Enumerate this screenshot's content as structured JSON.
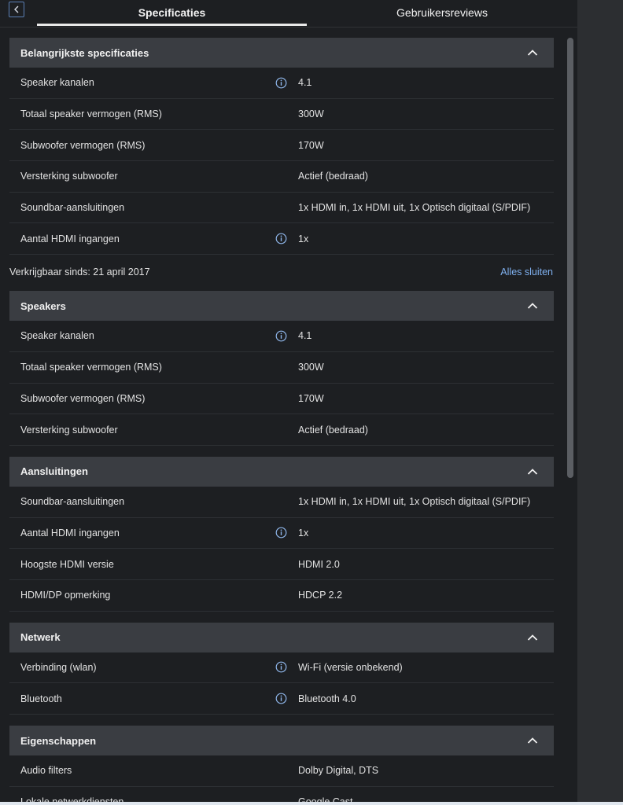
{
  "tabs": [
    {
      "label": "Specificaties",
      "active": true
    },
    {
      "label": "Gebruikersreviews",
      "active": false
    }
  ],
  "sections": [
    {
      "title": "Belangrijkste specificaties",
      "rows": [
        {
          "label": "Speaker kanalen",
          "value": "4.1",
          "info": true
        },
        {
          "label": "Totaal speaker vermogen (RMS)",
          "value": "300W",
          "info": false
        },
        {
          "label": "Subwoofer vermogen (RMS)",
          "value": "170W",
          "info": false
        },
        {
          "label": "Versterking subwoofer",
          "value": "Actief (bedraad)",
          "info": false
        },
        {
          "label": "Soundbar-aansluitingen",
          "value": "1x HDMI in, 1x HDMI uit, 1x Optisch digitaal (S/PDIF)",
          "info": false
        },
        {
          "label": "Aantal HDMI ingangen",
          "value": "1x",
          "info": true
        }
      ]
    },
    {
      "title": "Speakers",
      "rows": [
        {
          "label": "Speaker kanalen",
          "value": "4.1",
          "info": true
        },
        {
          "label": "Totaal speaker vermogen (RMS)",
          "value": "300W",
          "info": false
        },
        {
          "label": "Subwoofer vermogen (RMS)",
          "value": "170W",
          "info": false
        },
        {
          "label": "Versterking subwoofer",
          "value": "Actief (bedraad)",
          "info": false
        }
      ]
    },
    {
      "title": "Aansluitingen",
      "rows": [
        {
          "label": "Soundbar-aansluitingen",
          "value": "1x HDMI in, 1x HDMI uit, 1x Optisch digitaal (S/PDIF)",
          "info": false
        },
        {
          "label": "Aantal HDMI ingangen",
          "value": "1x",
          "info": true
        },
        {
          "label": "Hoogste HDMI versie",
          "value": "HDMI 2.0",
          "info": false
        },
        {
          "label": "HDMI/DP opmerking",
          "value": "HDCP 2.2",
          "info": false
        }
      ]
    },
    {
      "title": "Netwerk",
      "rows": [
        {
          "label": "Verbinding (wlan)",
          "value": "Wi-Fi (versie onbekend)",
          "info": true
        },
        {
          "label": "Bluetooth",
          "value": "Bluetooth 4.0",
          "info": true
        }
      ]
    },
    {
      "title": "Eigenschappen",
      "rows": [
        {
          "label": "Audio filters",
          "value": "Dolby Digital, DTS",
          "info": false
        },
        {
          "label": "Lokale netwerkdiensten",
          "value": "Google Cast",
          "info": false
        }
      ]
    }
  ],
  "availability": {
    "text": "Verkrijgbaar sinds: 21 april 2017",
    "close_all": "Alles sluiten"
  },
  "colors": {
    "accent_link": "#7fb0ef",
    "header_bg": "#3a3d42",
    "page_bg": "#1d1f22"
  },
  "icons": {
    "back": "chevron-left-icon",
    "collapse": "chevron-up-icon",
    "info": "info-icon"
  }
}
